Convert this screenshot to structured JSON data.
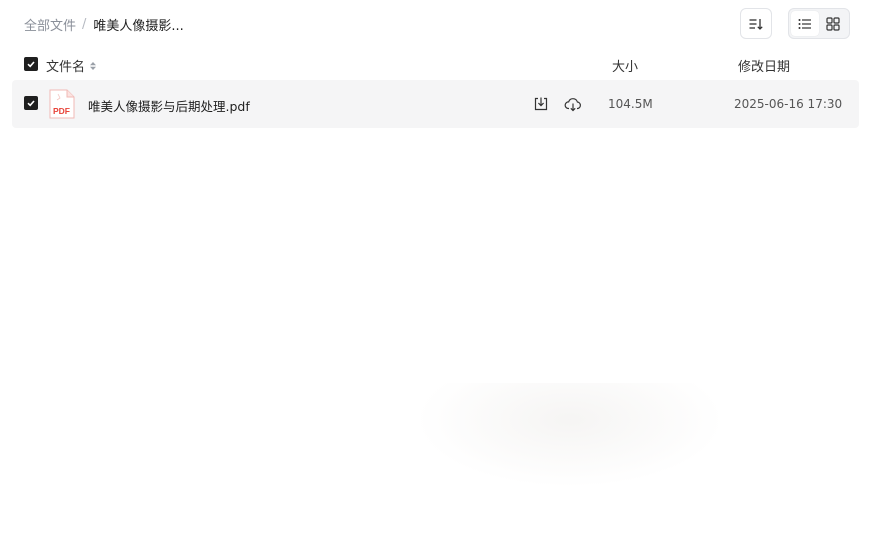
{
  "breadcrumb": {
    "root": "全部文件",
    "separator": "/",
    "current": "唯美人像摄影..."
  },
  "toolbar": {
    "sort_icon": "sort-descending-icon",
    "view_modes": [
      {
        "icon": "list-view-icon",
        "active": true
      },
      {
        "icon": "grid-view-icon",
        "active": false
      }
    ]
  },
  "table": {
    "columns": {
      "name": "文件名",
      "size": "大小",
      "date": "修改日期"
    },
    "select_all_checked": true,
    "rows": [
      {
        "checked": true,
        "icon": "pdf-file-icon",
        "icon_text": "PDF",
        "name": "唯美人像摄影与后期处理.pdf",
        "size": "104.5M",
        "modified": "2025-06-16 17:30",
        "actions": [
          "download-icon",
          "cloud-save-icon"
        ]
      }
    ]
  },
  "colors": {
    "accent_dark": "#1f1f1f",
    "row_bg": "#f5f5f6",
    "pdf_red": "#e8443a"
  }
}
